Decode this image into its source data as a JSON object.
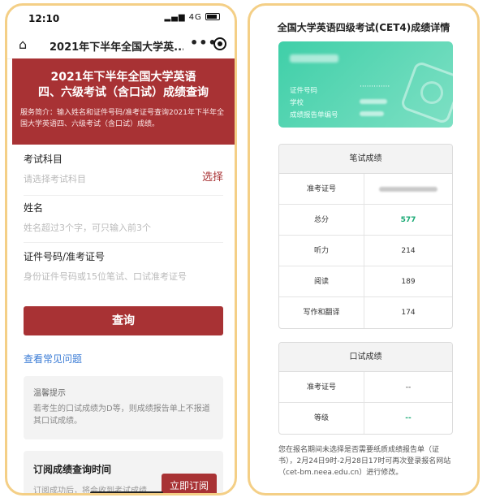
{
  "left": {
    "status": {
      "time": "12:10",
      "network": "4G"
    },
    "nav": {
      "title": "2021年下半年全国大学英..."
    },
    "banner": {
      "title_line1": "2021年下半年全国大学英语",
      "title_line2": "四、六级考试（含口试）成绩查询",
      "description": "服务简介：输入姓名和证件号码/准考证号查询2021年下半年全国大学英语四、六级考试（含口试）成绩。"
    },
    "form": {
      "subject_label": "考试科目",
      "subject_placeholder": "请选择考试科目",
      "subject_action": "选择",
      "name_label": "姓名",
      "name_placeholder": "姓名超过3个字，可只输入前3个",
      "id_label": "证件号码/准考证号",
      "id_placeholder": "身份证件号码或15位笔试、口试准考证号",
      "submit_label": "查询"
    },
    "faq_link": "查看常见问题",
    "tip": {
      "title": "温馨提示",
      "body": "若考生的口试成绩为D等，则成绩报告单上不报道其口试成绩。"
    },
    "subscribe": {
      "title": "订阅成绩查询时间",
      "desc": "订阅成功后，将会收到考试成绩",
      "button_label": "立即订阅"
    }
  },
  "right": {
    "title": "全国大学英语四级考试(CET4)成绩详情",
    "card": {
      "id_label": "证件号码",
      "id_value": "·············",
      "school_label": "学校",
      "report_label": "成绩报告单编号"
    },
    "written": {
      "header": "笔试成绩",
      "rows": [
        {
          "label": "准考证号",
          "value": ""
        },
        {
          "label": "总分",
          "value": "577"
        },
        {
          "label": "听力",
          "value": "214"
        },
        {
          "label": "阅读",
          "value": "189"
        },
        {
          "label": "写作和翻译",
          "value": "174"
        }
      ]
    },
    "oral": {
      "header": "口试成绩",
      "rows": [
        {
          "label": "准考证号",
          "value": "--"
        },
        {
          "label": "等级",
          "value": "--"
        }
      ]
    },
    "note": "您在报名期间未选择是否需要纸质成绩报告单（证书），2月24日9时-2月28日17时可再次登录报名网站（cet-bm.neea.edu.cn）进行修改。",
    "colors": {
      "accent_red": "#a83234",
      "card_green": "#3fcfa8",
      "score_green": "#19a974"
    }
  }
}
